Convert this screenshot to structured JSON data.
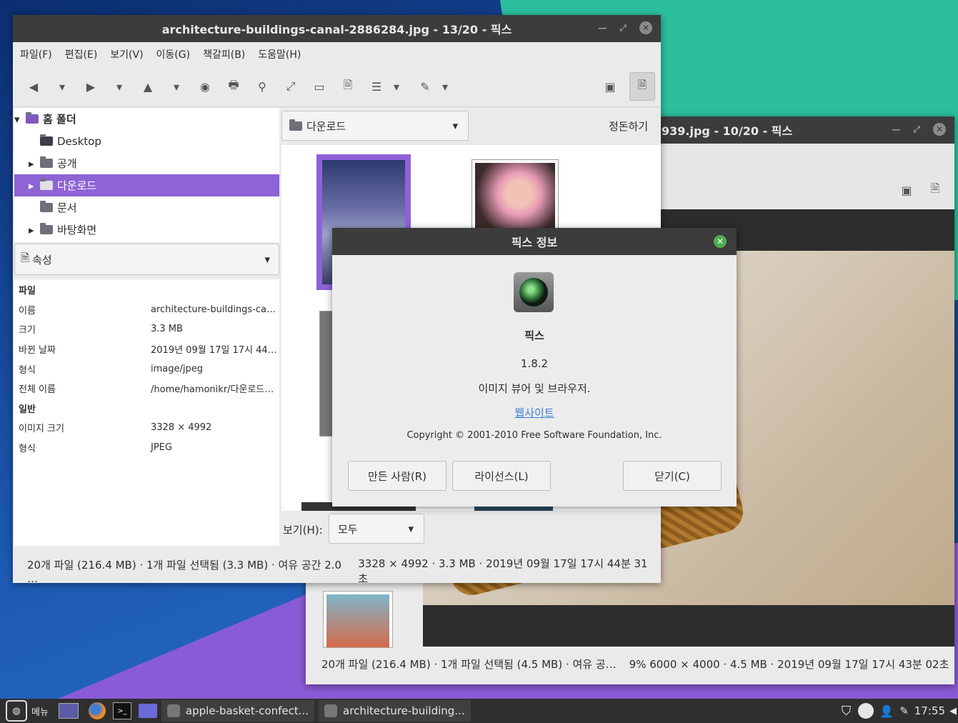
{
  "main_window": {
    "title": "architecture-buildings-canal-2886284.jpg - 13/20 - 픽스",
    "menu": [
      "파일(F)",
      "편집(E)",
      "보기(V)",
      "이동(G)",
      "책갈피(B)",
      "도움말(H)"
    ],
    "tree": {
      "home": "홈 폴더",
      "items": [
        "Desktop",
        "공개",
        "다운로드",
        "문서",
        "바탕화면"
      ]
    },
    "properties_combo": "속성",
    "props": {
      "section_file": "파일",
      "name_label": "이름",
      "name_value": "architecture-buildings-ca…",
      "size_label": "크기",
      "size_value": "3.3 MB",
      "date_label": "바뀐 날짜",
      "date_value": "2019년 09월 17일 17시 44…",
      "type_label": "형식",
      "type_value": "image/jpeg",
      "fullname_label": "전체 이름",
      "fullname_value": "/home/hamonikr/다운로드…",
      "section_general": "일반",
      "dim_label": "이미지 크기",
      "dim_value": "3328 × 4992",
      "format_label": "형식",
      "format_value": "JPEG"
    },
    "folder_combo": "다운로드",
    "sort_label": "정돈하기",
    "view_label": "보기(H):",
    "view_combo": "모두",
    "status_left": "20개 파일 (216.4 MB) · 1개 파일 선택됨 (3.3 MB) · 여유 공간 2.0 …",
    "status_right": "3328 × 4992 · 3.3 MB · 2019년 09월 17일 17시 44분 31초"
  },
  "back_window": {
    "title": "939.jpg - 10/20 - 픽스",
    "status_left": "20개 파일 (216.4 MB) · 1개 파일 선택됨 (4.5 MB) · 여유 공…",
    "status_right": "9%  6000 × 4000 · 4.5 MB · 2019년 09월 17일 17시 43분 02초"
  },
  "about": {
    "title": "픽스 정보",
    "app_name": "픽스",
    "version": "1.8.2",
    "description": "이미지 뷰어 및 브라우저.",
    "website": "웹사이트",
    "copyright": "Copyright © 2001-2010 Free Software Foundation, Inc.",
    "credits": "만든 사람(R)",
    "license": "라이선스(L)",
    "close": "닫기(C)"
  },
  "taskbar": {
    "menu": "메뉴",
    "task1": "apple-basket-confect...",
    "task2": "architecture-building...",
    "clock": "17:55"
  },
  "colors": {
    "selection": "#8e63d6",
    "titlebar": "#3c3c3c",
    "link": "#3b7dd8",
    "teal": "#2bbf9e"
  }
}
